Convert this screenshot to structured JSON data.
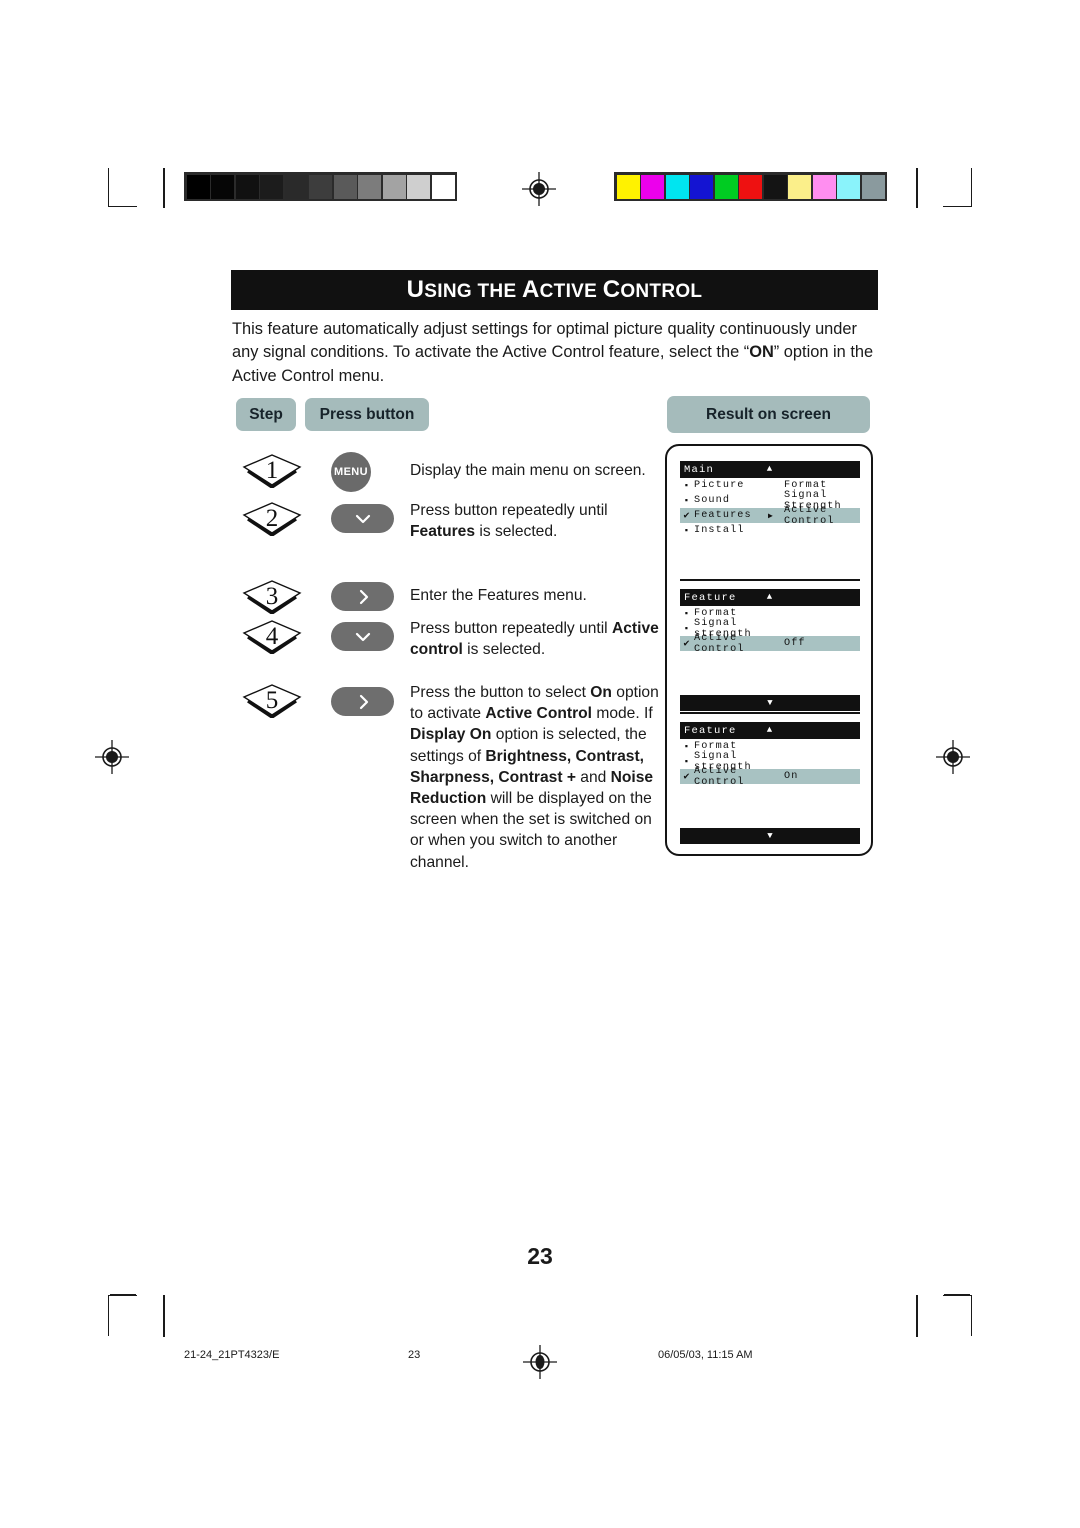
{
  "header": {
    "title_first_cap": "U",
    "title_rest": "SING THE ",
    "title": "USING THE ACTIVE CONTROL",
    "parts": [
      "U",
      "SING THE ",
      "A",
      "CTIVE ",
      "C",
      "ONTROL"
    ]
  },
  "intro": {
    "line": "This feature automatically adjust settings for optimal picture quality continuously under any signal conditions. To activate the Active Control feature, select the “ON” option in the Active Control menu.",
    "p1": "This feature automatically adjust settings for optimal picture quality continuously under any signal conditions. To activate the Active Control feature, select the “",
    "emphasis": "ON",
    "p2": "” option in the Active Control menu."
  },
  "table_headers": {
    "step": "Step",
    "press_button": "Press button",
    "result_on_screen": "Result on screen"
  },
  "steps": [
    {
      "number": "1",
      "button_label": "MENU",
      "button_icon": "menu-button",
      "text": "Display the main menu on screen."
    },
    {
      "number": "2",
      "button_label": "",
      "button_icon": "chevron-down-icon",
      "text_plain": "Press button repeatedly until Features is selected.",
      "text_a": "Press button repeatedly until ",
      "text_b": "Features",
      "text_c": " is selected."
    },
    {
      "number": "3",
      "button_label": "",
      "button_icon": "chevron-right-icon",
      "text": "Enter the Features menu."
    },
    {
      "number": "4",
      "button_label": "",
      "button_icon": "chevron-down-icon",
      "text_plain": "Press button repeatedly until Active control is selected.",
      "text_a": "Press button repeatedly until ",
      "text_b": "Active control",
      "text_c": " is selected."
    },
    {
      "number": "5",
      "button_label": "",
      "button_icon": "chevron-right-icon",
      "text_plain": "Press the button to select On option to activate Active Control mode. If Display On option is selected, the settings of Brightness, Contrast, Sharpness, Contrast + and Noise Reduction will be displayed on the screen when the set is switched on or when you switch to another channel.",
      "frag": [
        {
          "t": "Press the button to select ",
          "b": false
        },
        {
          "t": "On",
          "b": true
        },
        {
          "t": " option to activate ",
          "b": false
        },
        {
          "t": "Active Control",
          "b": true
        },
        {
          "t": " mode.",
          "b": false
        },
        {
          "t": " If ",
          "b": false
        },
        {
          "t": "Display On",
          "b": true
        },
        {
          "t": " option is selected, the settings of ",
          "b": false
        },
        {
          "t": "Brightness, Contrast, Sharpness, Contrast +",
          "b": true
        },
        {
          "t": " and ",
          "b": false
        },
        {
          "t": "Noise Reduction",
          "b": true
        },
        {
          "t": " will be displayed on the screen when the set is switched on or when you switch to another channel.",
          "b": false
        }
      ]
    }
  ],
  "osd_panels": [
    {
      "title": "Main",
      "up_arrow": "▲",
      "rows": [
        {
          "marker": "▪",
          "label": "Picture",
          "arrow": "",
          "value": "Format",
          "selected": false
        },
        {
          "marker": "▪",
          "label": "Sound",
          "arrow": "",
          "value": "Signal Strength",
          "selected": false
        },
        {
          "marker": "✔",
          "label": "Features",
          "arrow": "▶",
          "value": "Active Control",
          "selected": true
        },
        {
          "marker": "▪",
          "label": "Install",
          "arrow": "",
          "value": "",
          "selected": false
        }
      ],
      "footer": ""
    },
    {
      "title": "Feature",
      "up_arrow": "▲",
      "rows": [
        {
          "marker": "▪",
          "label": "Format",
          "arrow": "",
          "value": "",
          "selected": false
        },
        {
          "marker": "▪",
          "label": "Signal strength",
          "arrow": "",
          "value": "",
          "selected": false
        },
        {
          "marker": "✔",
          "label": "Active Control",
          "arrow": "",
          "value": "Off",
          "selected": true
        }
      ],
      "footer": "▼"
    },
    {
      "title": "Feature",
      "up_arrow": "▲",
      "rows": [
        {
          "marker": "▪",
          "label": "Format",
          "arrow": "",
          "value": "",
          "selected": false
        },
        {
          "marker": "▪",
          "label": "Signal strength",
          "arrow": "",
          "value": "",
          "selected": false
        },
        {
          "marker": "✔",
          "label": "Active Control",
          "arrow": "",
          "value": "On",
          "selected": true
        }
      ],
      "footer": "▼"
    }
  ],
  "page_number": "23",
  "footer": {
    "file": "21-24_21PT4323/E",
    "page": "23",
    "date": "06/05/03, 11:15 AM"
  },
  "print_marks": {
    "gray_bar": [
      "#000000",
      "#060606",
      "#111111",
      "#1c1c1c",
      "#2a2a2a",
      "#3d3d3d",
      "#5a5a5a",
      "#7c7c7c",
      "#a3a3a3",
      "#cfcfcf",
      "#ffffff"
    ],
    "color_bar": [
      "#fff200",
      "#ec00ec",
      "#00e5f0",
      "#1414d2",
      "#00cc22",
      "#ee1111",
      "#141414",
      "#fbef8a",
      "#ff8ef0",
      "#8af3fb",
      "#8a9a9e"
    ]
  },
  "colors": {
    "accent_pill": "#a5bbbb",
    "osd_highlight": "#a8c2c2",
    "button_gray": "#6e6e6e",
    "title_band": "#111111"
  }
}
